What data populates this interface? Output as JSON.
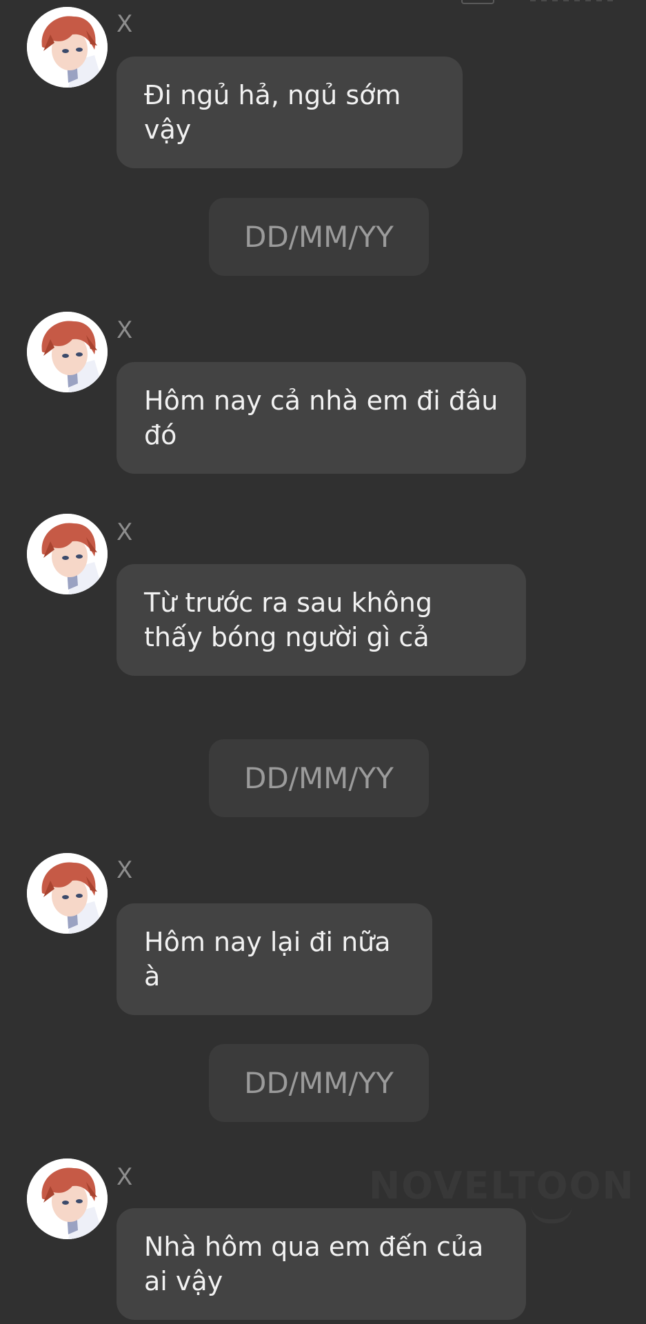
{
  "watermark": "NOVELTOON",
  "messages": [
    {
      "sender": "X",
      "text": "Đi ngủ hả, ngủ sớm vậy"
    },
    {
      "sender": "X",
      "text": "Hôm nay cả nhà em đi đâu đó"
    },
    {
      "sender": "X",
      "text": "Từ trước ra sau không thấy bóng người gì cả"
    },
    {
      "sender": "X",
      "text": "Hôm nay lại đi nữa à"
    },
    {
      "sender": "X",
      "text": "Nhà hôm qua em đến của ai vậy"
    }
  ],
  "dates": [
    "DD/MM/YY",
    "DD/MM/YY",
    "DD/MM/YY"
  ],
  "colors": {
    "background": "#303030",
    "bubble": "#434343",
    "date_pill": "#3b3b3b",
    "hair": "#c65a46"
  },
  "icons": {
    "avatar": "anime-red-hair-avatar"
  }
}
